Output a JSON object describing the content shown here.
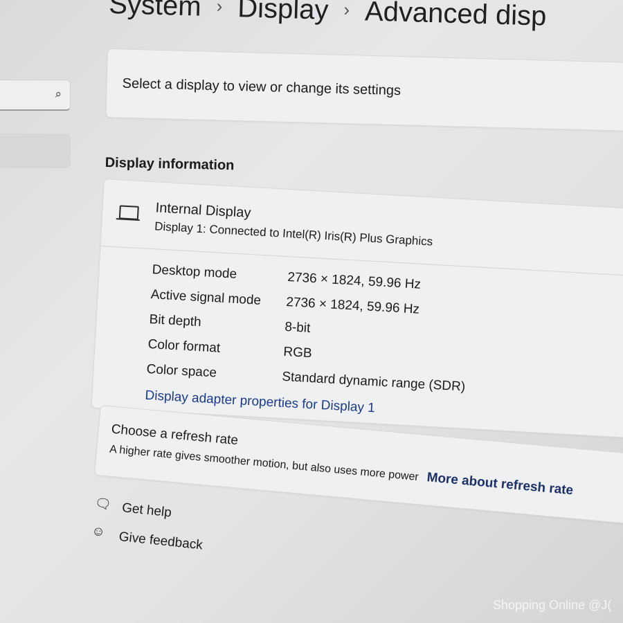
{
  "breadcrumb": {
    "items": [
      "System",
      "Display",
      "Advanced disp"
    ]
  },
  "search": {
    "icon": "search-icon"
  },
  "select_card": {
    "text": "Select a display to view or change its settings"
  },
  "display_info": {
    "section_title": "Display information",
    "name": "Internal Display",
    "subtitle": "Display 1: Connected to Intel(R) Iris(R) Plus Graphics",
    "rows": [
      {
        "label": "Desktop mode",
        "value": "2736 × 1824, 59.96 Hz"
      },
      {
        "label": "Active signal mode",
        "value": "2736 × 1824, 59.96 Hz"
      },
      {
        "label": "Bit depth",
        "value": "8-bit"
      },
      {
        "label": "Color format",
        "value": "RGB"
      },
      {
        "label": "Color space",
        "value": "Standard dynamic range (SDR)"
      }
    ],
    "adapter_link": "Display adapter properties for Display 1"
  },
  "refresh": {
    "title": "Choose a refresh rate",
    "description": "A higher rate gives smoother motion, but also uses more power",
    "link": "More about refresh rate"
  },
  "footer": {
    "help": "Get help",
    "feedback": "Give feedback"
  },
  "watermark": "Shopping Online @J("
}
